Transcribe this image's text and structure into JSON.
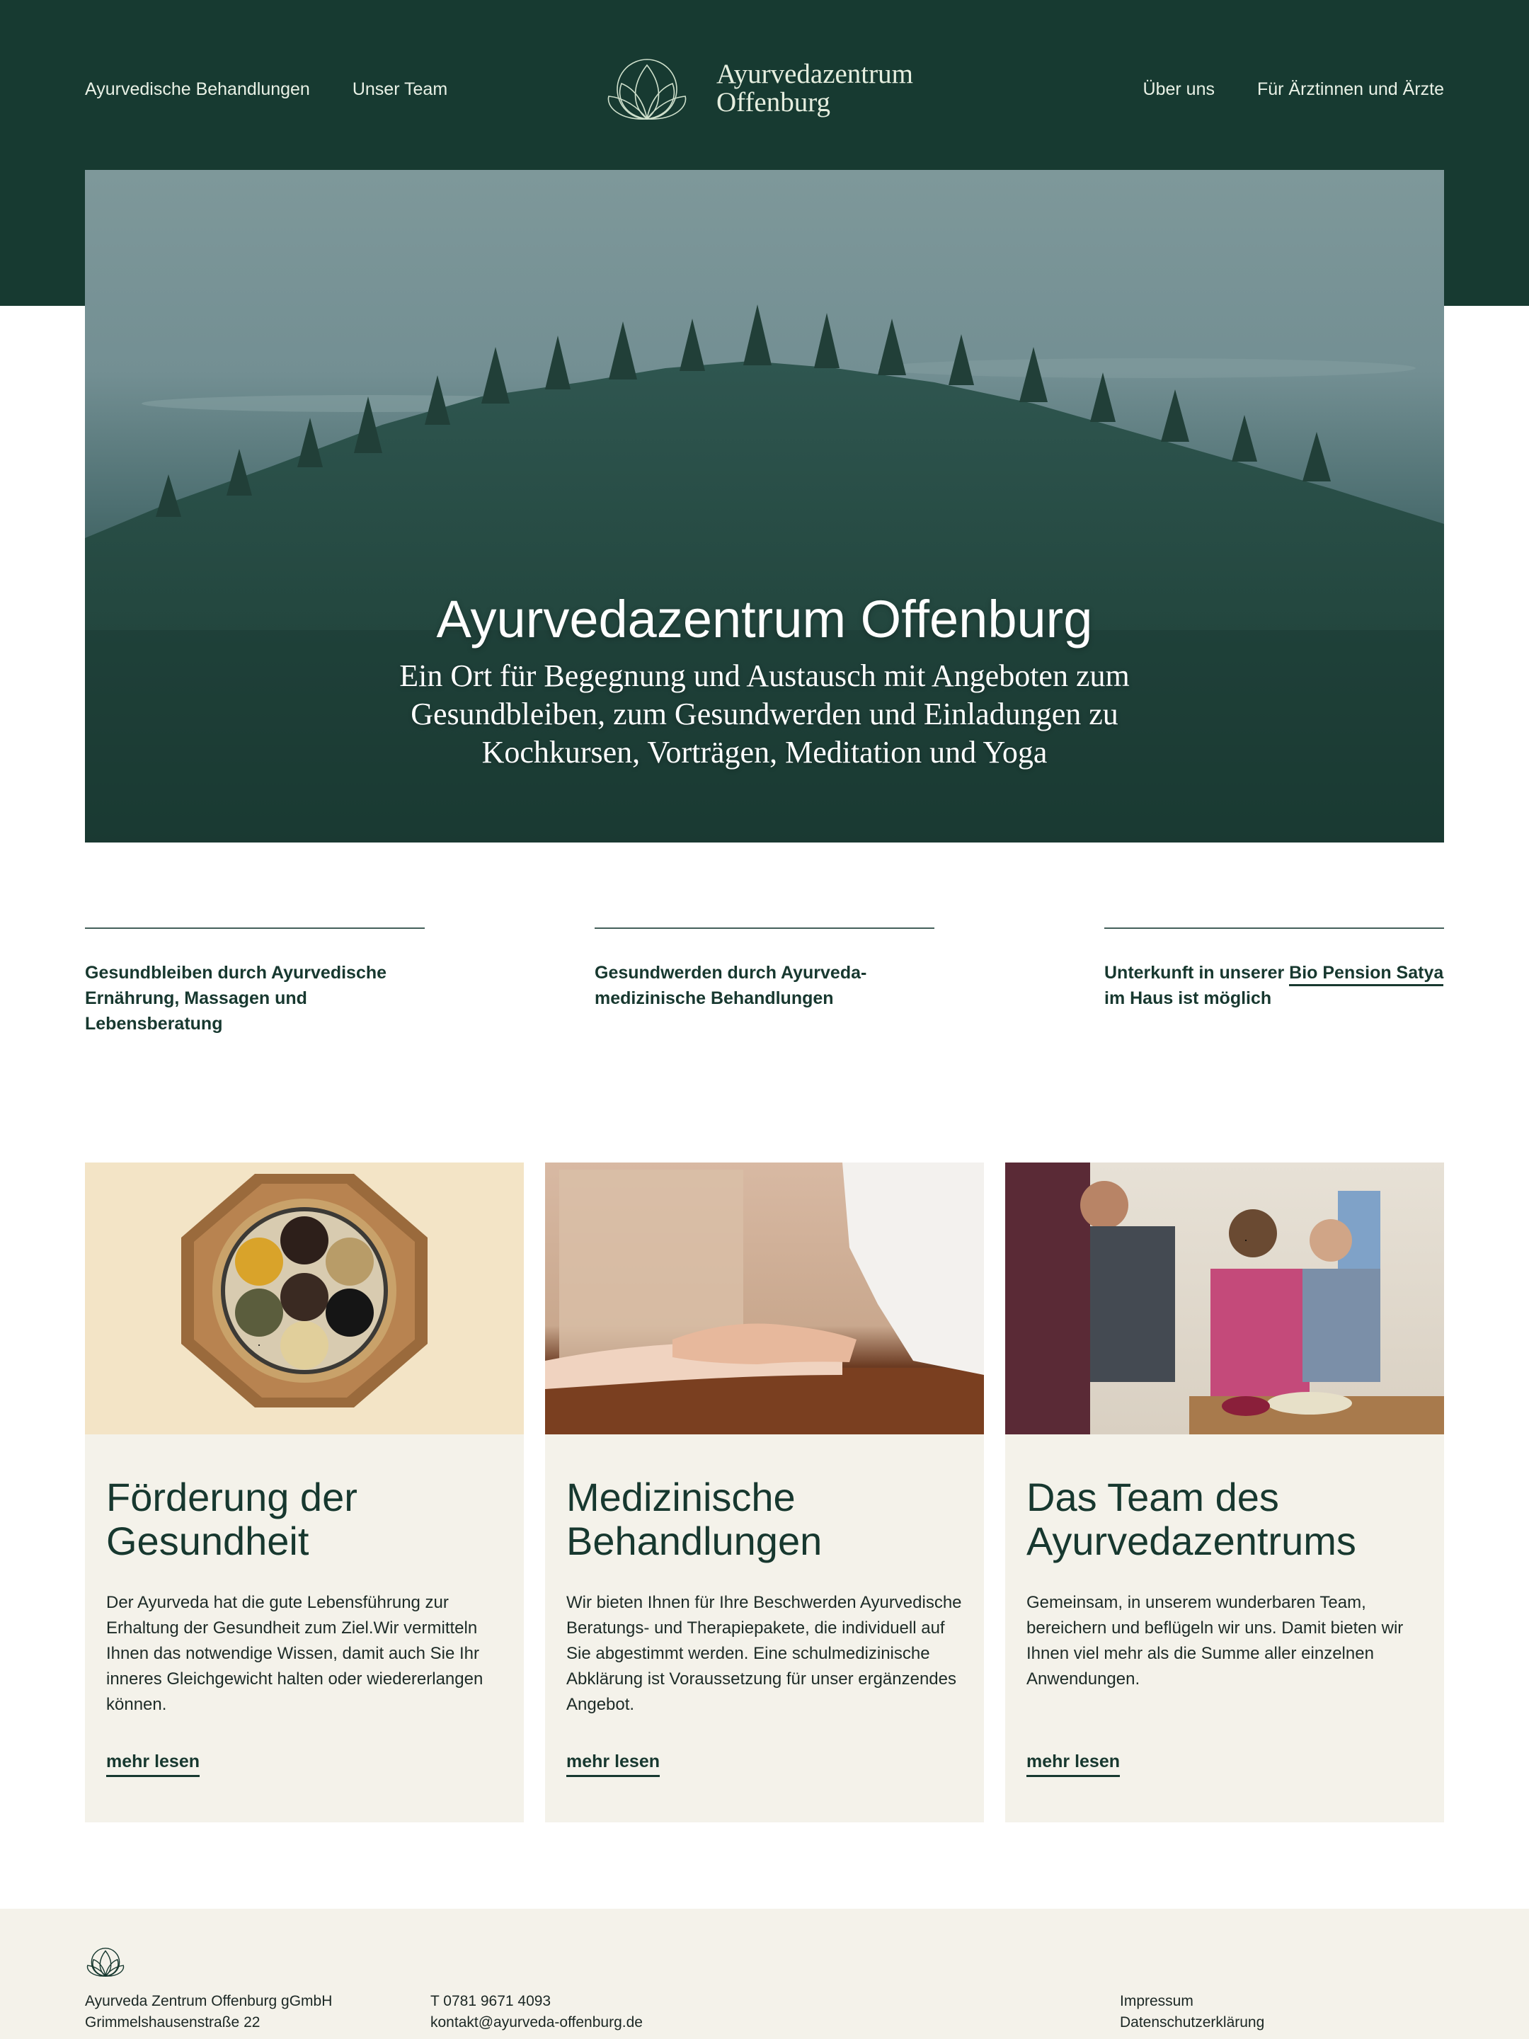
{
  "header": {
    "nav_left": [
      "Ayurvedische Behandlungen",
      "Unser Team"
    ],
    "nav_right": [
      "Über uns",
      "Für Ärztinnen und Ärzte"
    ],
    "logo_line1": "Ayurvedazentrum",
    "logo_line2": "Offenburg"
  },
  "hero": {
    "title": "Ayurvedazentrum Offenburg",
    "subtitle": "Ein Ort für Begegnung und Austausch mit Angeboten zum Gesundbleiben, zum Gesundwerden und Einladungen zu Kochkursen, Vorträgen, Meditation und Yoga"
  },
  "features": [
    {
      "text": "Gesundbleiben durch Ayurvedische Ernährung, Massagen und Lebensberatung"
    },
    {
      "text": "Gesundwerden durch Ayurveda-medizinische Behandlungen"
    },
    {
      "text_before": "Unterkunft in unserer ",
      "link": "Bio Pension Satya",
      "text_after": " im Haus ist möglich"
    }
  ],
  "cards": [
    {
      "title": "Förderung der Gesundheit",
      "text": "Der Ayurveda hat die gute Lebensführung zur Erhaltung der Gesundheit zum Ziel.Wir vermitteln Ihnen das notwendige Wissen, damit auch Sie Ihr inneres Gleichgewicht halten oder wiedererlangen können.",
      "more": "mehr lesen"
    },
    {
      "title": "Medizinische Behandlungen",
      "text": "Wir bieten Ihnen für Ihre Beschwerden Ayurvedische Beratungs- und Therapiepakete, die individuell auf Sie abgestimmt werden. Eine schulmedizinische Abklärung ist Voraussetzung für unser ergänzendes Angebot.",
      "more": "mehr lesen"
    },
    {
      "title": "Das Team des Ayurvedazentrums",
      "text": "Gemeinsam, in unserem wunderbaren Team, bereichern und beflügeln wir uns. Damit bieten wir Ihnen viel mehr als die Summe aller einzelnen Anwendungen.",
      "more": "mehr lesen"
    }
  ],
  "footer": {
    "company": "Ayurveda Zentrum Offenburg gGmbH",
    "street": "Grimmelshausenstraße 22",
    "phone": "T 0781 9671 4093",
    "email": "kontakt@ayurveda-offenburg.de",
    "impressum": "Impressum",
    "privacy": "Datenschutzerklärung"
  },
  "colors": {
    "brand_dark_green": "#173a31",
    "cream": "#f4f2ea",
    "text_green": "#17382f"
  }
}
